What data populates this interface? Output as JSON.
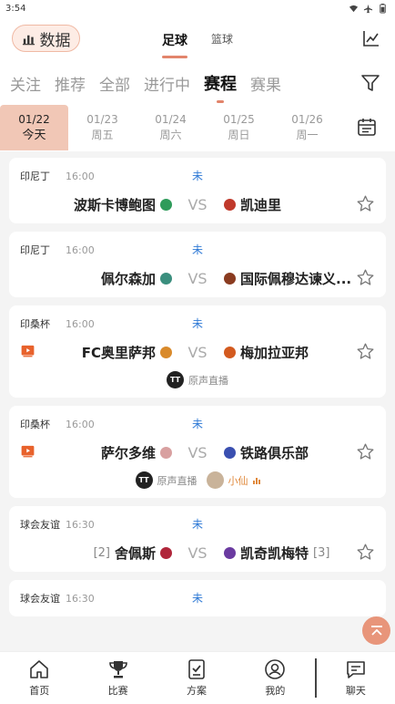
{
  "status_bar": {
    "time": "3:54"
  },
  "header": {
    "data_button": "数据",
    "sport_tabs": [
      {
        "label": "足球",
        "active": true
      },
      {
        "label": "篮球",
        "active": false
      }
    ]
  },
  "categories": [
    {
      "label": "关注",
      "active": false
    },
    {
      "label": "推荐",
      "active": false
    },
    {
      "label": "全部",
      "active": false
    },
    {
      "label": "进行中",
      "active": false
    },
    {
      "label": "赛程",
      "active": true
    },
    {
      "label": "赛果",
      "active": false
    }
  ],
  "dates": [
    {
      "date": "01/22",
      "weekday": "今天",
      "active": true
    },
    {
      "date": "01/23",
      "weekday": "周五",
      "active": false
    },
    {
      "date": "01/24",
      "weekday": "周六",
      "active": false
    },
    {
      "date": "01/25",
      "weekday": "周日",
      "active": false
    },
    {
      "date": "01/26",
      "weekday": "周一",
      "active": false
    }
  ],
  "matches": [
    {
      "league": "印尼丁",
      "time": "16:00",
      "status": "未",
      "home": "波斯卡博鲍图",
      "away": "凯迪里",
      "home_rank": "",
      "away_rank": "",
      "vs": "VS",
      "has_video": false,
      "home_badge_color": "#2e9b5a",
      "away_badge_color": "#c0392b",
      "streams": []
    },
    {
      "league": "印尼丁",
      "time": "16:00",
      "status": "未",
      "home": "佩尔森加",
      "away": "国际佩穆达谏义...",
      "home_rank": "",
      "away_rank": "",
      "vs": "VS",
      "has_video": false,
      "home_badge_color": "#3b8f7e",
      "away_badge_color": "#8a3b20",
      "streams": []
    },
    {
      "league": "印桑杯",
      "time": "16:00",
      "status": "未",
      "home": "FC奥里萨邦",
      "away": "梅加拉亚邦",
      "home_rank": "",
      "away_rank": "",
      "vs": "VS",
      "has_video": true,
      "home_badge_color": "#d98a2b",
      "away_badge_color": "#d35a1f",
      "streams": [
        {
          "type": "official",
          "logo": "TT",
          "label": "原声直播"
        }
      ]
    },
    {
      "league": "印桑杯",
      "time": "16:00",
      "status": "未",
      "home": "萨尔多维",
      "away": "铁路俱乐部",
      "home_rank": "",
      "away_rank": "",
      "vs": "VS",
      "has_video": true,
      "home_badge_color": "#d8a0a0",
      "away_badge_color": "#3a4fb0",
      "streams": [
        {
          "type": "official",
          "logo": "TT",
          "label": "原声直播"
        },
        {
          "type": "user",
          "logo": "",
          "label": "小仙"
        }
      ]
    },
    {
      "league": "球会友谊",
      "time": "16:30",
      "status": "未",
      "home": "舍佩斯",
      "away": "凯奇凯梅特",
      "home_rank": "[2]",
      "away_rank": "[3]",
      "vs": "VS",
      "has_video": false,
      "home_badge_color": "#b0263a",
      "away_badge_color": "#6a3aa0",
      "streams": []
    },
    {
      "league": "球会友谊",
      "time": "16:30",
      "status": "未",
      "home": "",
      "away": "",
      "home_rank": "",
      "away_rank": "",
      "vs": "",
      "has_video": false,
      "home_badge_color": "#999999",
      "away_badge_color": "#999999",
      "streams": []
    }
  ],
  "bottom_nav": [
    {
      "label": "首页",
      "icon": "home-icon"
    },
    {
      "label": "比赛",
      "icon": "trophy-icon"
    },
    {
      "label": "方案",
      "icon": "checklist-icon"
    },
    {
      "label": "我的",
      "icon": "user-icon"
    },
    {
      "label": "聊天",
      "icon": "chat-icon"
    }
  ],
  "colors": {
    "accent": "#e2846b",
    "accent_light": "#f1c7b6",
    "status_blue": "#2f7ad6"
  }
}
